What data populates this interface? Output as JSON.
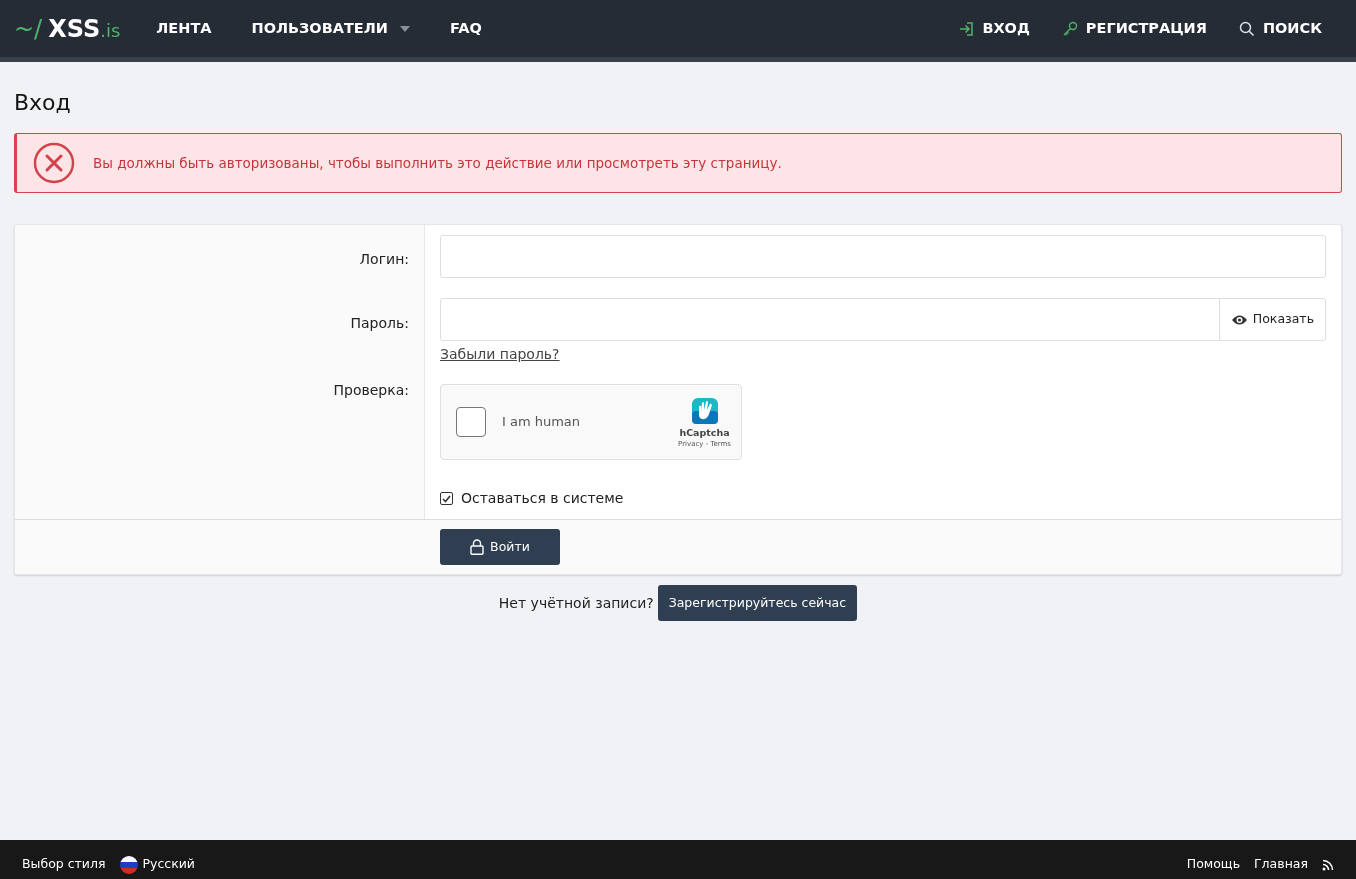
{
  "header": {
    "logo": {
      "prefix": "~/",
      "name": "XSS",
      "suffix": ".is"
    },
    "nav": [
      {
        "label": "ЛЕНТА",
        "has_dropdown": false
      },
      {
        "label": "ПОЛЬЗОВАТЕЛИ",
        "has_dropdown": true
      },
      {
        "label": "FAQ",
        "has_dropdown": false
      }
    ],
    "right_nav": [
      {
        "label": "ВХОД",
        "kind": "login"
      },
      {
        "label": "РЕГИСТРАЦИЯ",
        "kind": "register"
      },
      {
        "label": "ПОИСК",
        "kind": "search"
      }
    ]
  },
  "page_title": "Вход",
  "alert": {
    "text": "Вы должны быть авторизованы, чтобы выполнить это действие или просмотреть эту страницу."
  },
  "form": {
    "login": {
      "label": "Логин:"
    },
    "password": {
      "label": "Пароль:",
      "toggle": "Показать",
      "forgot_link": "Забыли пароль?"
    },
    "captcha": {
      "label": "Проверка:",
      "checkbox_text": "I am human",
      "checked": false,
      "brand": "hCaptcha",
      "links": "Privacy - Terms"
    },
    "remember": {
      "label": "Оставаться в системе",
      "checked": true
    },
    "submit": "Войти"
  },
  "register_prompt": {
    "text": "Нет учётной записи?",
    "button": "Зарегистрируйтесь сейчас"
  },
  "footer": {
    "left": [
      {
        "label": "Выбор стиля",
        "kind": "text"
      },
      {
        "label": "Русский",
        "kind": "language"
      }
    ],
    "right": [
      {
        "label": "Помощь",
        "kind": "text"
      },
      {
        "label": "Главная",
        "kind": "text"
      },
      {
        "kind": "rss"
      }
    ]
  }
}
